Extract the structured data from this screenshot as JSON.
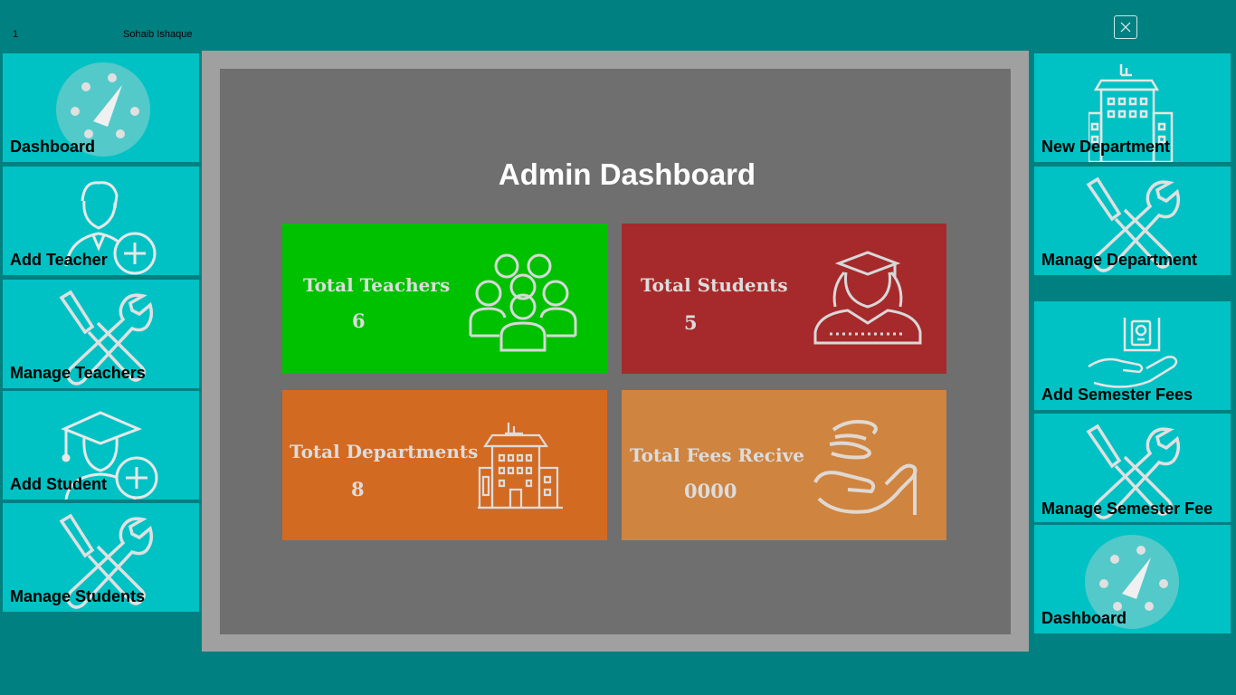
{
  "header": {
    "user_id": "1",
    "user_name": "Sohaib Ishaque"
  },
  "colors": {
    "background": "#008080",
    "tile": "#00c2c4",
    "frame": "#a0a0a0",
    "panel": "#6f6f6f",
    "teachers_card": "#00c100",
    "students_card": "#a62a2b",
    "departments_card": "#d36a22",
    "fees_card": "#cf8440"
  },
  "left_menu": [
    {
      "label": "Dashboard",
      "icon": "dashboard-gauge-icon"
    },
    {
      "label": "Add Teacher",
      "icon": "add-teacher-icon"
    },
    {
      "label": "Manage Teachers",
      "icon": "wrench-screwdriver-icon"
    },
    {
      "label": "Add Student",
      "icon": "add-student-icon"
    },
    {
      "label": "Manage Students",
      "icon": "wrench-screwdriver-icon"
    }
  ],
  "right_menu": [
    {
      "label": "New Department",
      "icon": "building-icon"
    },
    {
      "label": "Manage Department",
      "icon": "wrench-screwdriver-icon"
    },
    {
      "label": "Add Semester Fees",
      "icon": "fees-hand-icon"
    },
    {
      "label": "Manage Semester Fee",
      "icon": "wrench-screwdriver-icon"
    },
    {
      "label": "Dashboard",
      "icon": "dashboard-gauge-icon"
    }
  ],
  "main": {
    "title": "Admin Dashboard",
    "cards": [
      {
        "label": "Total Teachers",
        "value": "6",
        "icon": "teachers-group-icon"
      },
      {
        "label": "Total Students",
        "value": "5",
        "icon": "graduate-student-icon"
      },
      {
        "label": "Total Departments",
        "value": "8",
        "icon": "building-icon"
      },
      {
        "label": "Total Fees Recive",
        "value": "0000",
        "icon": "coins-hand-icon"
      }
    ]
  }
}
